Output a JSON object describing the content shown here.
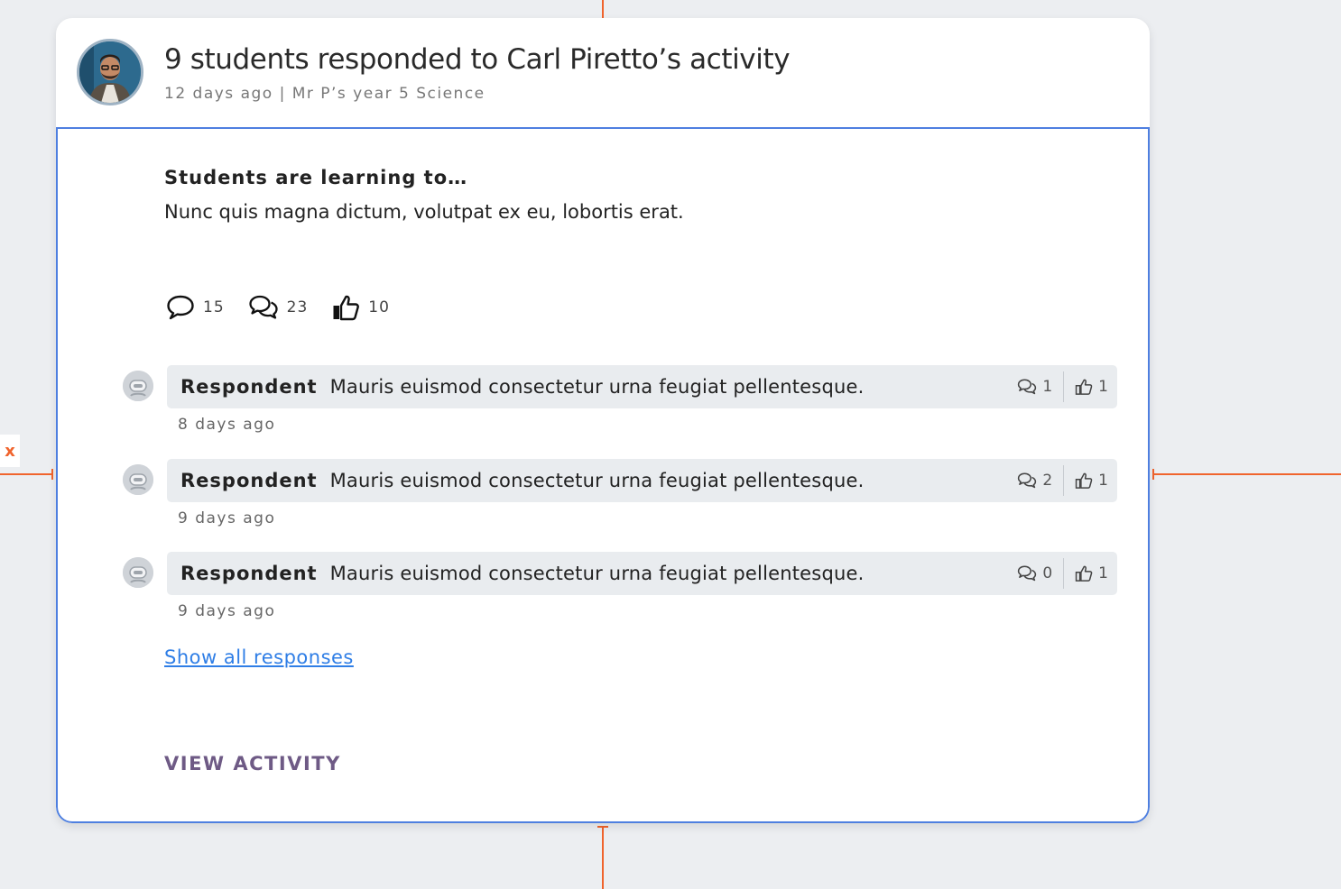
{
  "activity": {
    "title": "9 students responded to Carl Piretto’s activity",
    "meta": "12 days ago | Mr P’s year 5 Science",
    "learning_heading": "Students are learning to…",
    "learning_text": "Nunc quis magna dictum, volutpat ex eu, lobortis erat."
  },
  "stats": {
    "comments": "15",
    "replies": "23",
    "likes": "10"
  },
  "responses": [
    {
      "name": "Respondent",
      "text": "Mauris euismod consectetur urna feugiat pellentesque.",
      "replies": "1",
      "likes": "1",
      "time": "8 days ago"
    },
    {
      "name": "Respondent",
      "text": "Mauris euismod consectetur urna feugiat pellentesque.",
      "replies": "2",
      "likes": "1",
      "time": "9 days ago"
    },
    {
      "name": "Respondent",
      "text": "Mauris euismod consectetur urna feugiat pellentesque.",
      "replies": "0",
      "likes": "1",
      "time": "9 days ago"
    }
  ],
  "links": {
    "show_all": "Show all responses",
    "view_activity": "VIEW ACTIVITY"
  },
  "annotation": {
    "tag": "x"
  },
  "colors": {
    "link": "#2f7ee6",
    "action": "#6e5a85",
    "redline": "#f0642d",
    "selection": "#4e7fe0"
  }
}
